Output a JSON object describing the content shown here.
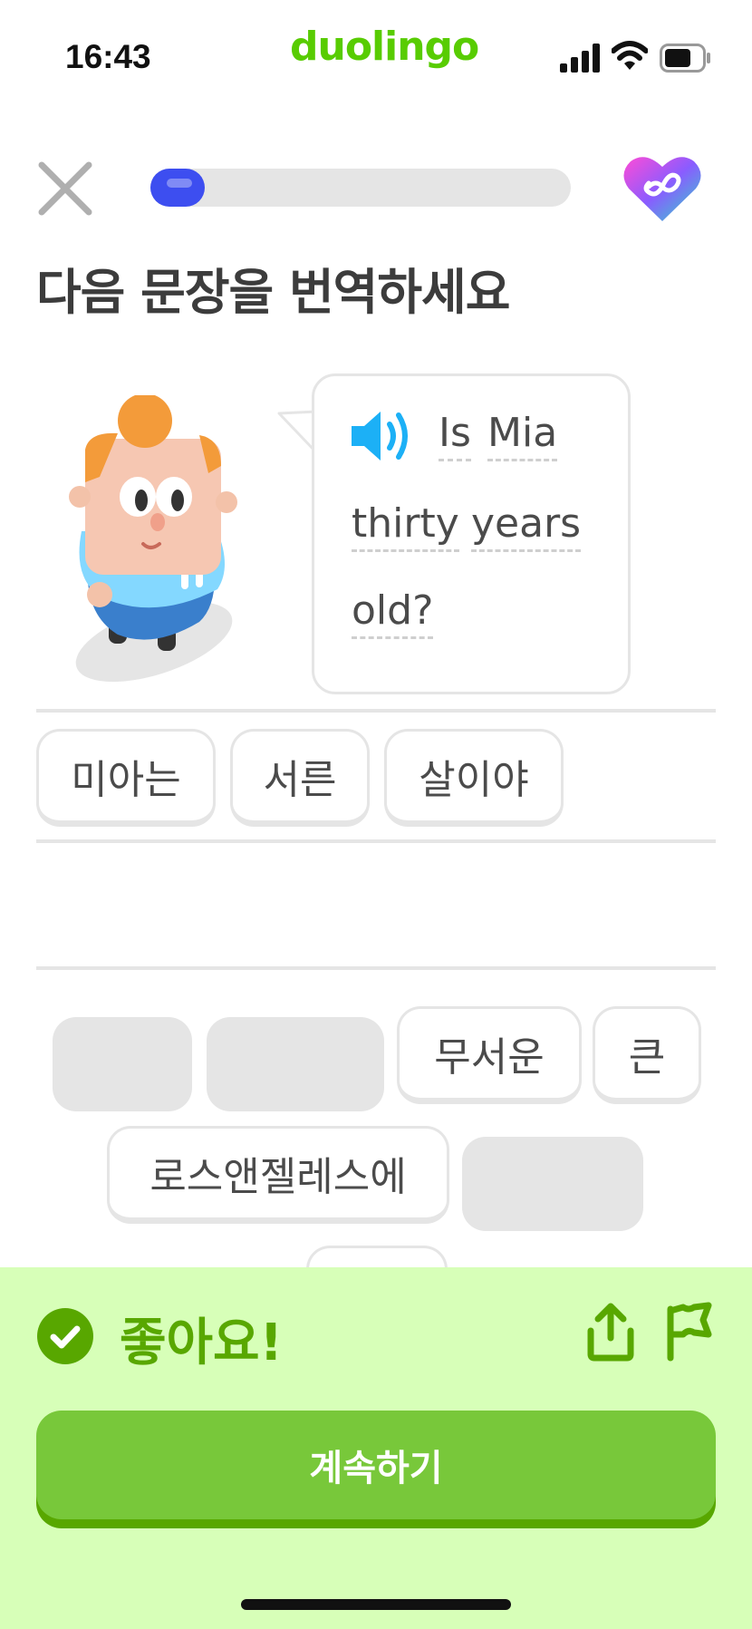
{
  "status_bar": {
    "time": "16:43",
    "brand": "duolingo"
  },
  "lesson": {
    "progress_fraction": 0.13,
    "title": "다음 문장을 번역하세요",
    "prompt_words": [
      "Is",
      "Mia",
      "thirty",
      "years",
      "old?"
    ]
  },
  "answer": {
    "tiles": [
      "미아는",
      "서른",
      "살이야"
    ]
  },
  "word_bank": {
    "tiles": [
      "무서운",
      "큰",
      "로스앤젤레스에"
    ]
  },
  "feedback": {
    "message": "좋아요!",
    "continue_label": "계속하기"
  },
  "colors": {
    "brand_green": "#58cc02",
    "progress_blue": "#3d4ef0",
    "panel_bg": "#d7ffb8",
    "feedback_green": "#58a700",
    "button_green": "#78c83a"
  },
  "icons": [
    "signal-icon",
    "wifi-icon",
    "battery-icon",
    "close-icon",
    "infinite-heart-icon",
    "speaker-icon",
    "check-circle-icon",
    "share-icon",
    "flag-icon"
  ]
}
